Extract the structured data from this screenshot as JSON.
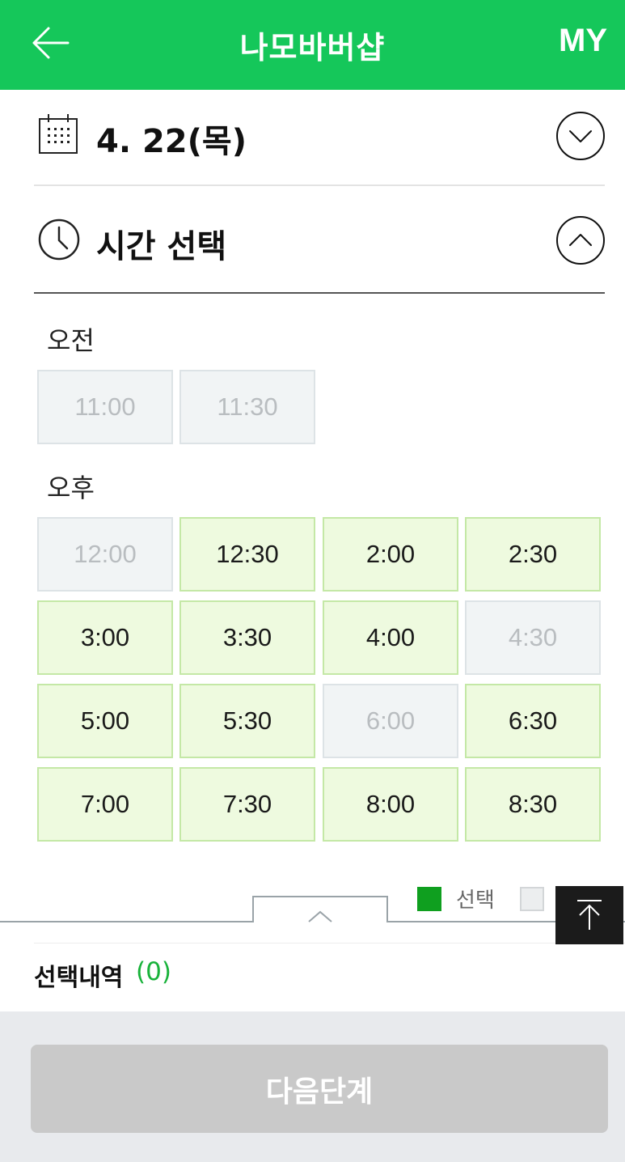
{
  "header": {
    "title": "나모바버샵",
    "my_label": "MY",
    "brand_color": "#15c75a"
  },
  "date_row": {
    "value": "4. 22(목)"
  },
  "time_row": {
    "label": "시간 선택"
  },
  "morning": {
    "label": "오전",
    "slots": [
      {
        "time": "11:00",
        "available": false
      },
      {
        "time": "11:30",
        "available": false
      }
    ]
  },
  "afternoon": {
    "label": "오후",
    "slots": [
      {
        "time": "12:00",
        "available": false
      },
      {
        "time": "12:30",
        "available": true
      },
      {
        "time": "2:00",
        "available": true
      },
      {
        "time": "2:30",
        "available": true
      },
      {
        "time": "3:00",
        "available": true
      },
      {
        "time": "3:30",
        "available": true
      },
      {
        "time": "4:00",
        "available": true
      },
      {
        "time": "4:30",
        "available": false
      },
      {
        "time": "5:00",
        "available": true
      },
      {
        "time": "5:30",
        "available": true
      },
      {
        "time": "6:00",
        "available": false
      },
      {
        "time": "6:30",
        "available": true
      },
      {
        "time": "7:00",
        "available": true
      },
      {
        "time": "7:30",
        "available": true
      },
      {
        "time": "8:00",
        "available": true
      },
      {
        "time": "8:30",
        "available": true
      }
    ]
  },
  "legend": {
    "selected_label": "선택",
    "selected_color": "#0f9f1f"
  },
  "selection_summary": {
    "label": "선택내역",
    "count": "(0)"
  },
  "next_button": {
    "label": "다음단계"
  }
}
